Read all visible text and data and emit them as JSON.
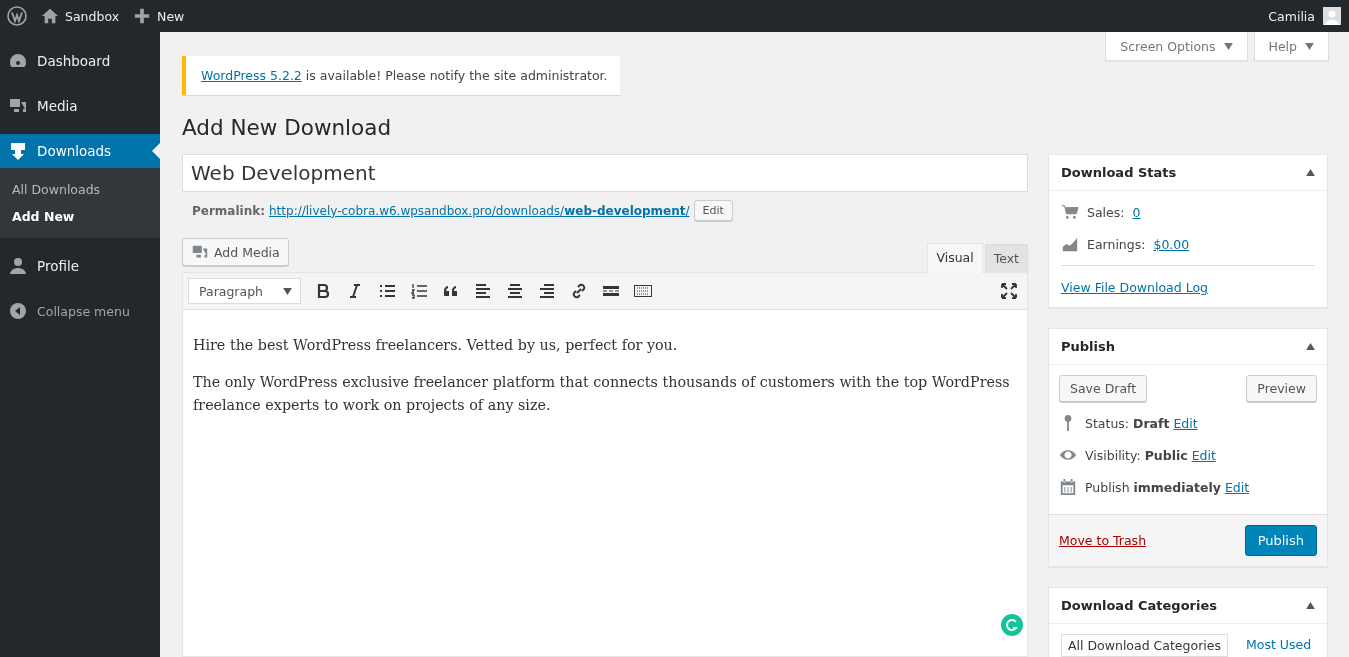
{
  "admin_bar": {
    "site": "Sandbox",
    "new": "New",
    "user": "Camilia"
  },
  "sidebar": {
    "items": [
      {
        "kind": "dashboard",
        "label": "Dashboard",
        "selected": false
      },
      {
        "kind": "media",
        "label": "Media",
        "selected": false
      },
      {
        "kind": "download",
        "label": "Downloads",
        "selected": true,
        "children": [
          {
            "label": "All Downloads",
            "selected": false
          },
          {
            "label": "Add New",
            "selected": true
          }
        ]
      },
      {
        "kind": "profile",
        "label": "Profile",
        "selected": false
      }
    ],
    "collapse": "Collapse menu"
  },
  "screen_meta": [
    "Screen Options",
    "Help"
  ],
  "notice": {
    "link": "WordPress 5.2.2",
    "text": "is available! Please notify the site administrator."
  },
  "page_title": "Add New Download",
  "title_field": {
    "value": "Web Development"
  },
  "permalink": {
    "label": "Permalink:",
    "url": "http://lively-cobra.w6.wpsandbox.pro/downloads/**web-development**/",
    "edit": "Edit"
  },
  "editor": {
    "add_media": "Add Media",
    "tabs": [
      {
        "label": "Visual",
        "selected": true
      },
      {
        "label": "Text",
        "selected": false
      }
    ],
    "format": "Paragraph",
    "paragraphs": [
      "Hire the best WordPress freelancers. Vetted by us, perfect for you.",
      "The only WordPress exclusive freelancer platform that connects thousands of customers with the top WordPress freelance experts to work on projects of any size."
    ]
  },
  "stats_box": {
    "title": "Download Stats",
    "items": [
      {
        "kind": "sales",
        "label": "Sales:",
        "value": "0"
      },
      {
        "kind": "earnings",
        "label": "Earnings:",
        "value": "$0.00"
      }
    ],
    "log_link": "View File Download Log"
  },
  "publish_box": {
    "title": "Publish",
    "save_draft": "Save Draft",
    "preview": "Preview",
    "rows": [
      {
        "kind": "status",
        "text": "Status: **Draft**",
        "edit": "Edit"
      },
      {
        "kind": "visibility",
        "text": "Visibility: **Public**",
        "edit": "Edit"
      },
      {
        "kind": "schedule",
        "text": "Publish **immediately**",
        "edit": "Edit"
      }
    ],
    "trash": "Move to Trash",
    "publish": "Publish"
  },
  "categories_box": {
    "title": "Download Categories",
    "tabs": [
      {
        "label": "All Download Categories",
        "selected": true
      },
      {
        "label": "Most Used",
        "selected": false
      }
    ]
  }
}
